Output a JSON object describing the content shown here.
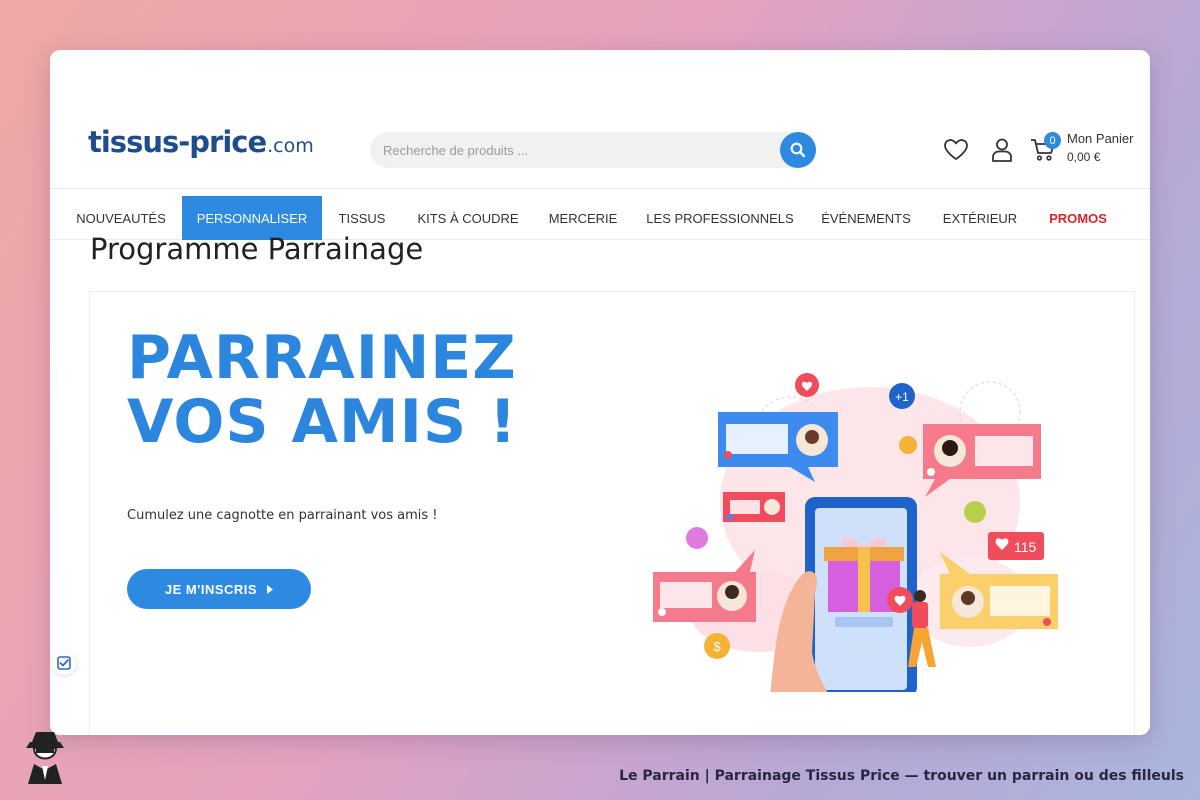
{
  "header": {
    "logo_main": "tissus-price",
    "logo_suffix": ".com",
    "search_placeholder": "Recherche de produits ...",
    "cart_count": "0",
    "cart_label": "Mon Panier",
    "cart_total": "0,00 €"
  },
  "nav": {
    "items": [
      {
        "label": "NOUVEAUTÉS"
      },
      {
        "label": "PERSONNALISER"
      },
      {
        "label": "TISSUS"
      },
      {
        "label": "KITS À COUDRE"
      },
      {
        "label": "MERCERIE"
      },
      {
        "label": "LES PROFESSIONNELS"
      },
      {
        "label": "ÉVÉNEMENTS"
      },
      {
        "label": "EXTÉRIEUR"
      },
      {
        "label": "PROMOS"
      }
    ]
  },
  "content": {
    "page_title": "Programme Parrainage",
    "headline_line1": "PARRAINEZ",
    "headline_line2": "VOS AMIS !",
    "subtitle": "Cumulez une cagnotte en parrainant vos amis !",
    "cta_label": "JE M'INSCRIS"
  },
  "illustration": {
    "plus_badge": "+1",
    "likes_count": "115"
  },
  "caption": {
    "text": "Le Parrain | Parrainage Tissus Price — trouver un parrain ou des filleuls"
  },
  "colors": {
    "accent": "#2d8ae0",
    "promo": "#e0222a",
    "logo": "#1f4d8c"
  }
}
